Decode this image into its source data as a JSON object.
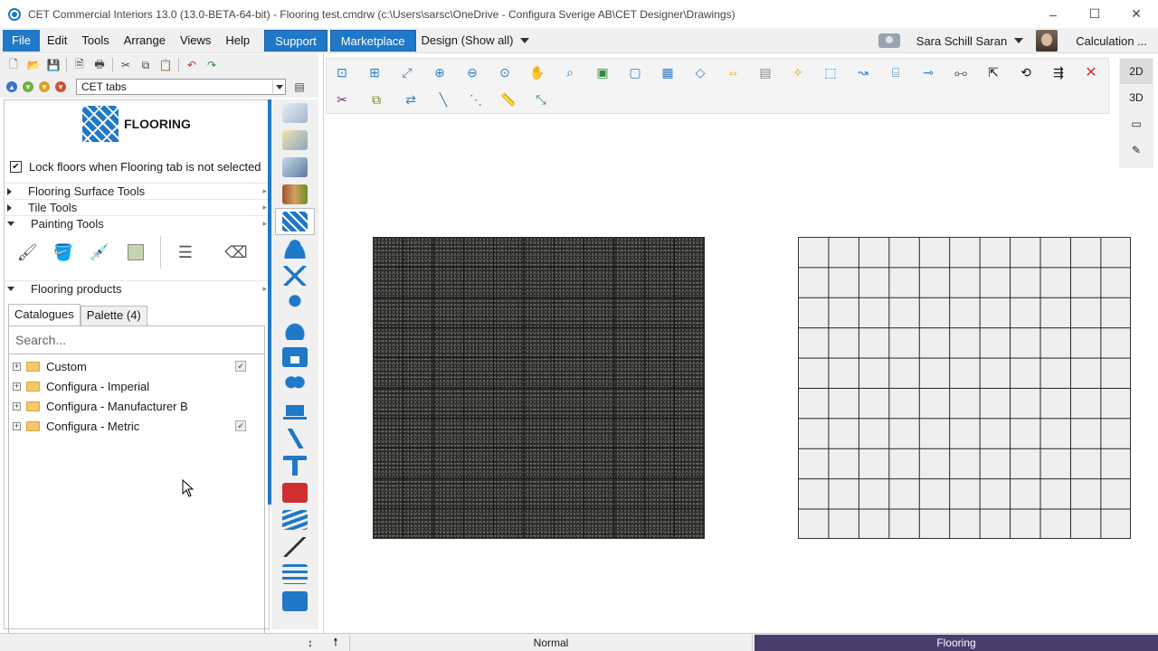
{
  "window": {
    "title": "CET Commercial Interiors 13.0 (13.0-BETA-64-bit) - Flooring test.cmdrw (c:\\Users\\sarsc\\OneDrive - Configura Sverige AB\\CET Designer\\Drawings)",
    "controls": [
      "–",
      "☐",
      "✕"
    ]
  },
  "menubar": {
    "items": [
      "File",
      "Edit",
      "Tools",
      "Arrange",
      "Views",
      "Help"
    ],
    "support_label": "Support",
    "marketplace_label": "Marketplace",
    "design_label": "Design (Show all)",
    "user_name": "Sara Schill Saran",
    "calculation_label": "Calculation ..."
  },
  "toolbar": {
    "tabs_select_value": "CET tabs"
  },
  "flooring_panel": {
    "title": "FLOORING",
    "lock_label": "Lock floors when Flooring tab is not selected",
    "lock_checked": true,
    "sections": [
      {
        "label": "Flooring Surface Tools",
        "expanded": false
      },
      {
        "label": "Tile Tools",
        "expanded": false
      },
      {
        "label": "Painting Tools",
        "expanded": true
      }
    ],
    "products_label": "Flooring products",
    "catalogue_tabs": [
      "Catalogues",
      "Palette (4)"
    ],
    "search_placeholder": "Search...",
    "catalogues": [
      {
        "label": "Custom",
        "checked": true
      },
      {
        "label": "Configura - Imperial",
        "checked": false
      },
      {
        "label": "Configura - Manufacturer B",
        "checked": false
      },
      {
        "label": "Configura - Metric",
        "checked": true
      }
    ]
  },
  "view_switcher": {
    "buttons": [
      "2D",
      "3D"
    ],
    "selected": "2D"
  },
  "statusbar": {
    "mode": "Normal",
    "active_tab": "Flooring"
  },
  "colors": {
    "accent": "#1f78c8",
    "status_active": "#4a3d6e",
    "dark_floor": "#2a2a28",
    "light_floor": "#efefef"
  }
}
